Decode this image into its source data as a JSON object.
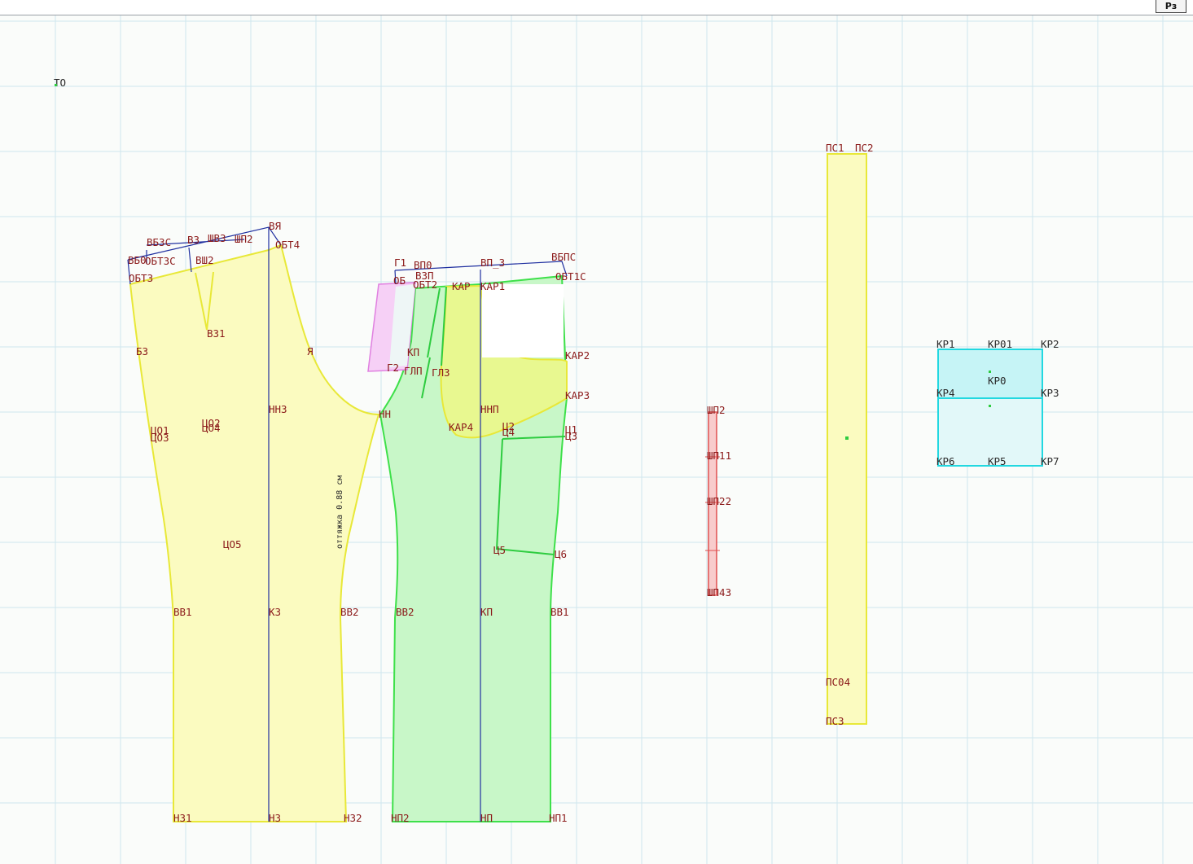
{
  "toolbar": {
    "tab_label": "Рз"
  },
  "colors": {
    "grid": "#cfe6ee",
    "back_fill": "#fbfbc0",
    "back_stroke": "#e8e838",
    "front_fill": "#c8f7c8",
    "front_stroke": "#3ee04a",
    "yoke_fill": "#e8f890",
    "waistband_fill": "#fbfbc0",
    "loops_fill": "#f8cccc",
    "loops_stroke": "#e05050",
    "pocket_fill": "#c6f4f6",
    "pocket_stroke": "#22d8e0",
    "facing_fill": "#f6d0f6",
    "facing_stroke": "#e080e0",
    "label_color": "#8b1a1a",
    "line_color": "#2030a0"
  },
  "labels": {
    "origin": "ТО",
    "back": [
      "ВЯ",
      "ОБТ4",
      "ВБЗС",
      "В3",
      "ШВ3",
      "ШП2",
      "ВБ0",
      "ОБТ3С",
      "ВШ2",
      "ОБТ3",
      "В31",
      "БЗ",
      "Я",
      "НН3",
      "ЦО1",
      "ЦО3",
      "ЦО2",
      "ЦО4",
      "НН",
      "ЦО5",
      "ВВ1",
      "КЗ",
      "ВВ2",
      "НЗ1",
      "НЗ",
      "НЗ2"
    ],
    "front": [
      "Г1",
      "ВП0",
      "ВЗП",
      "ВП_3",
      "ВБПС",
      "ОБТ1С",
      "ОБ",
      "ОБТ2",
      "КАР",
      "КАР1",
      "КП",
      "КАР2",
      "Г2",
      "ГЛП",
      "ГЛЗ",
      "КАР3",
      "ННП",
      "КАР4",
      "Ц2",
      "Ц4",
      "Ц1",
      "Ц3",
      "Ц5",
      "Ц6",
      "ВВ2",
      "КП",
      "ВВ1",
      "НП2",
      "НП",
      "НП1"
    ],
    "loops": [
      "ШП2",
      "ШП11",
      "ШП22",
      "ШП43"
    ],
    "waistband": [
      "ПС1",
      "ПС2",
      "ПС04",
      "ПС3"
    ],
    "pocket": [
      "КР1",
      "КР01",
      "КР2",
      "КР0",
      "КР4",
      "КР3",
      "КР6",
      "КР5",
      "КР7"
    ],
    "annotation": "оттяжка 0.88 см"
  }
}
